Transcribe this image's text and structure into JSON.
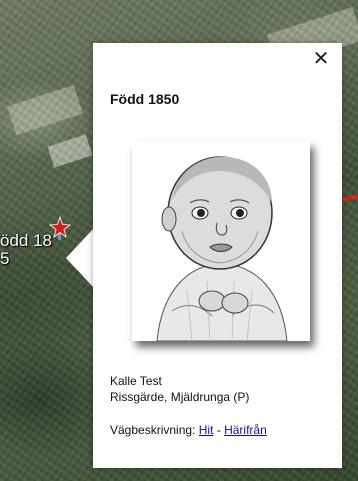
{
  "map": {
    "marker_label": "ödd 18\n5",
    "marker_icon": "red-star-pin-icon"
  },
  "popup": {
    "close_label": "✕",
    "title": "Född 1850",
    "photo": "baby-portrait-engraving",
    "name": "Kalle Test",
    "place": "Rissgärde, Mjäldrunga (P)",
    "directions": {
      "label": "Vägbeskrivning:",
      "to_here": "Hit",
      "separator": "-",
      "from_here": "Härifrån"
    }
  },
  "colors": {
    "link": "#1a0dab",
    "marker": "#d4201a"
  }
}
